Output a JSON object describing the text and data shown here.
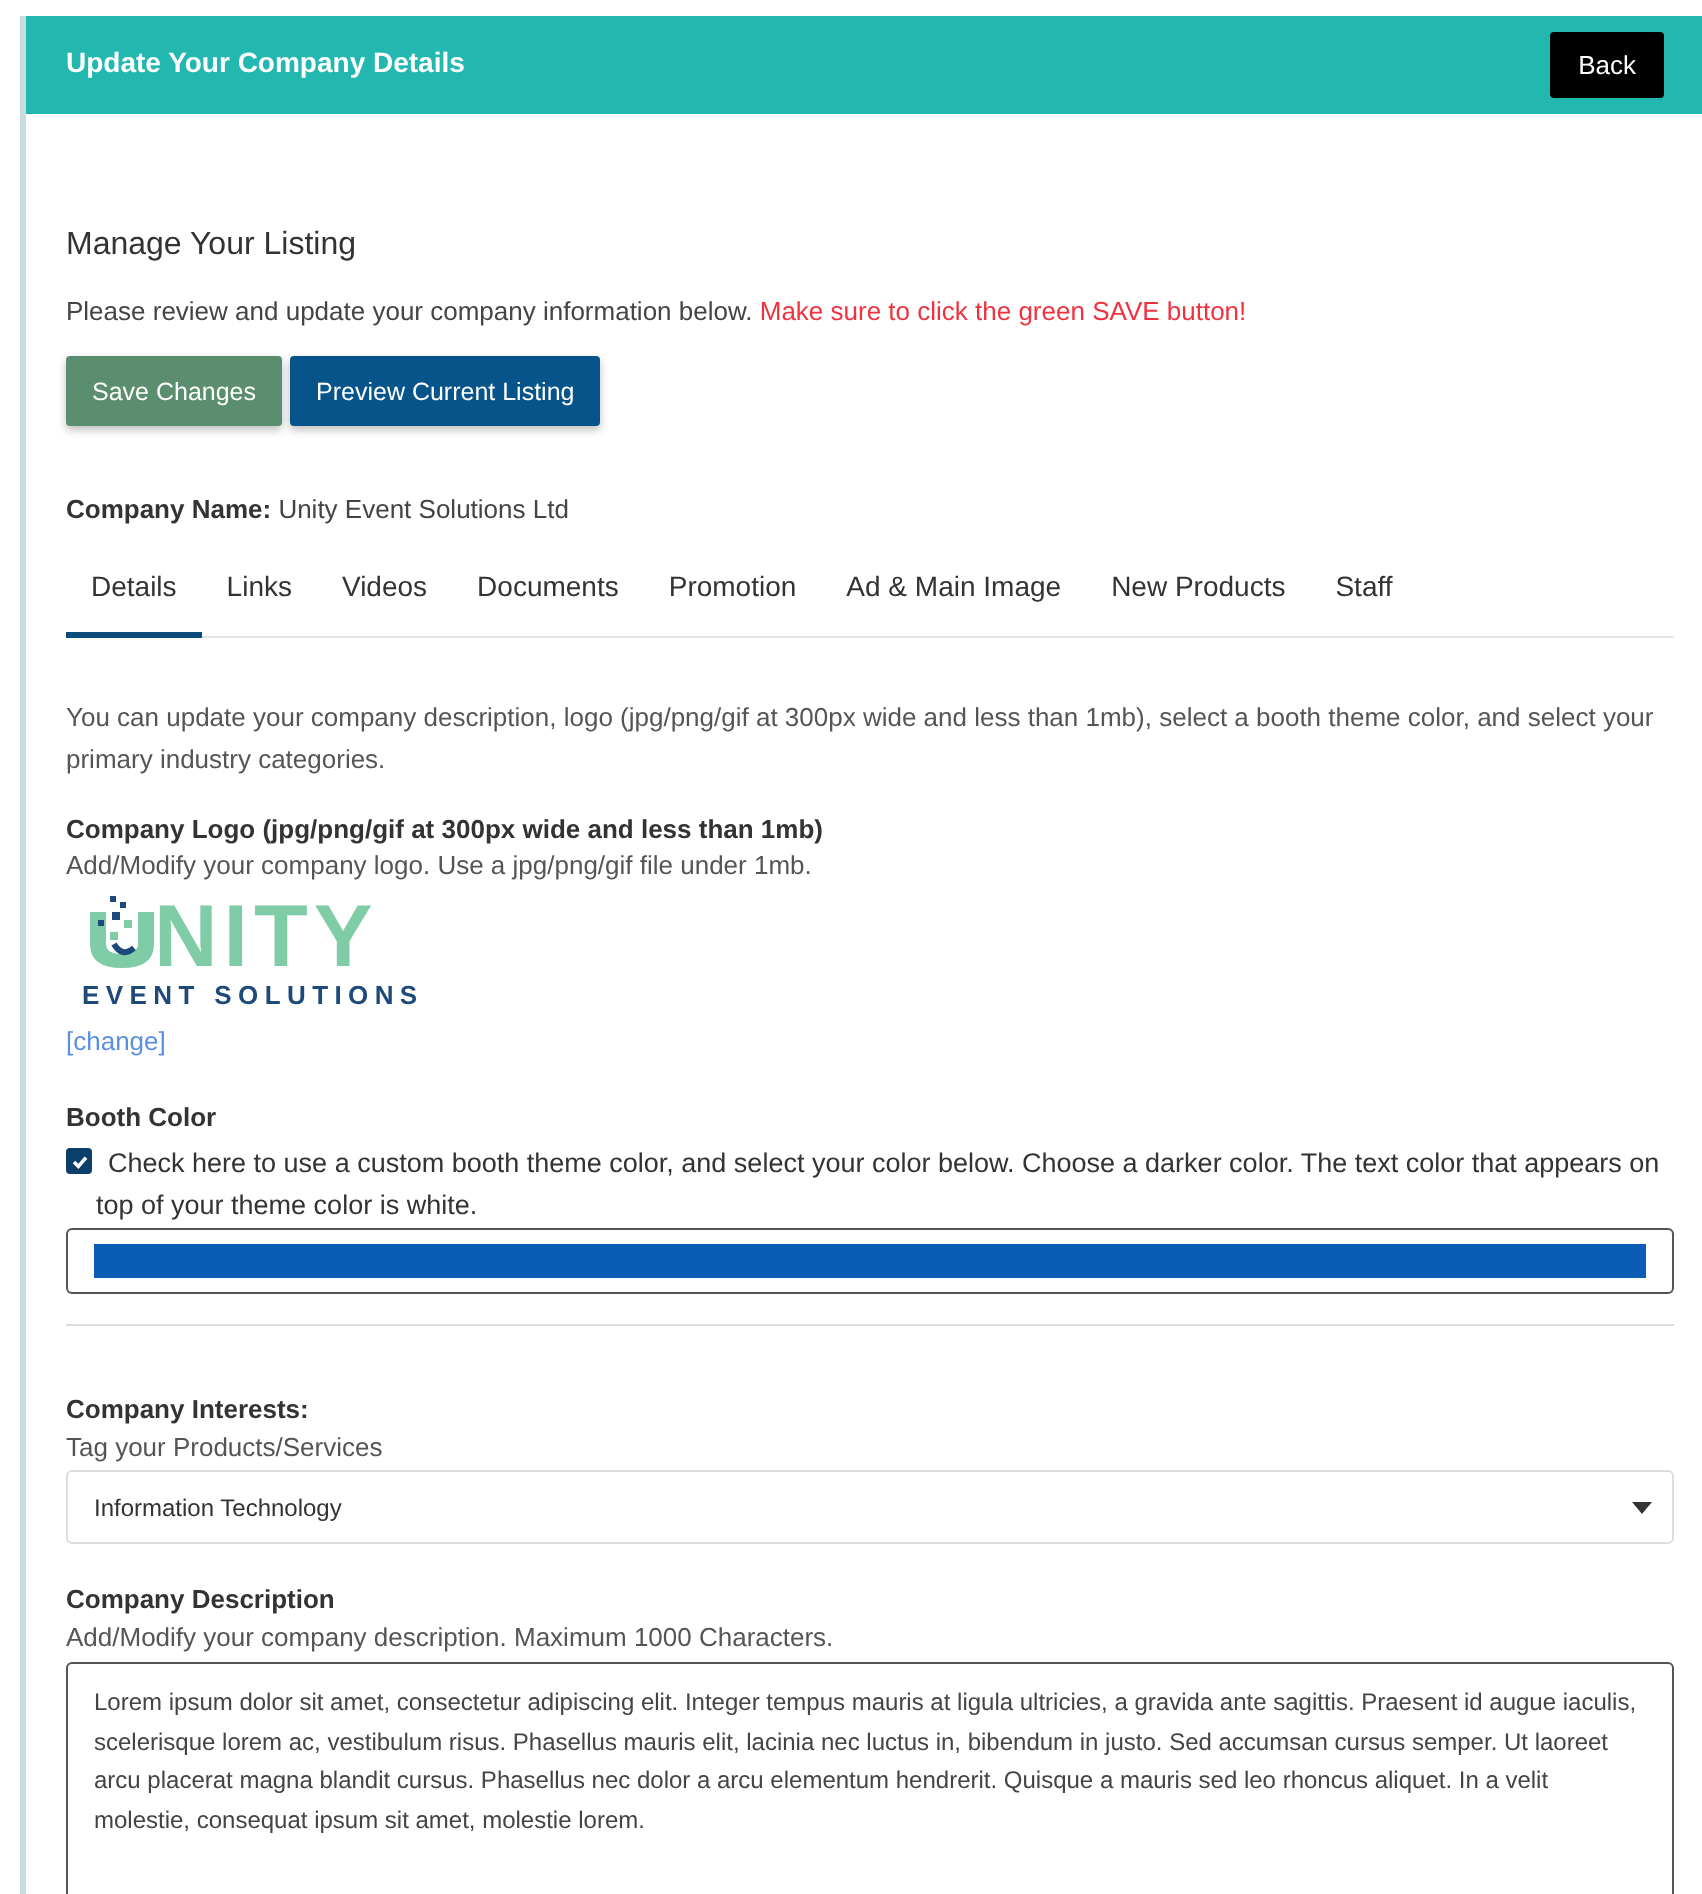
{
  "header": {
    "title": "Update Your Company Details",
    "back_button": "Back"
  },
  "heading": "Manage Your Listing",
  "intro": {
    "text": "Please review and update your company information below.",
    "warning": "Make sure to click the green SAVE button!"
  },
  "actions": [
    {
      "label": "Save Changes",
      "kind": "save"
    },
    {
      "label": "Preview Current Listing",
      "kind": "preview"
    }
  ],
  "company_name": {
    "label": "Company Name:",
    "value": "Unity Event Solutions Ltd"
  },
  "tabs": [
    {
      "label": "Details",
      "selected": true
    },
    {
      "label": "Links",
      "selected": false
    },
    {
      "label": "Videos",
      "selected": false
    },
    {
      "label": "Documents",
      "selected": false
    },
    {
      "label": "Promotion",
      "selected": false
    },
    {
      "label": "Ad & Main Image",
      "selected": false
    },
    {
      "label": "New Products",
      "selected": false
    },
    {
      "label": "Staff",
      "selected": false
    }
  ],
  "details_intro": "You can update your company description, logo (jpg/png/gif at 300px wide and less than 1mb), select a booth theme color, and select your primary industry categories.",
  "logo_section": {
    "label": "Company Logo (jpg/png/gif at 300px wide and less than 1mb)",
    "hint": "Add/Modify your company logo. Use a jpg/png/gif file under 1mb.",
    "logo_word": "NITY",
    "logo_sub": "EVENT SOLUTIONS",
    "change_link": "[change]"
  },
  "booth_color": {
    "label": "Booth Color",
    "checked": true,
    "checkbox_text": "Check here to use a custom booth theme color, and select your color below. Choose a darker color. The text color that appears on top of your theme color is white.",
    "color": "#0b5cb5"
  },
  "interests": {
    "label": "Company Interests:",
    "hint": "Tag your Products/Services",
    "value": "Information Technology"
  },
  "description": {
    "label": "Company Description",
    "hint": "Add/Modify your company description. Maximum 1000 Characters.",
    "value": "Lorem ipsum dolor sit amet, consectetur adipiscing elit. Integer tempus mauris at ligula ultricies, a gravida ante sagittis. Praesent id augue iaculis, scelerisque lorem ac, vestibulum risus. Phasellus mauris elit, lacinia nec luctus in, bibendum in justo. Sed accumsan cursus semper. Ut laoreet arcu placerat magna blandit cursus. Phasellus nec dolor a arcu elementum hendrerit. Quisque a mauris sed leo rhoncus aliquet. In a velit molestie, consequat ipsum sit amet, molestie lorem."
  }
}
